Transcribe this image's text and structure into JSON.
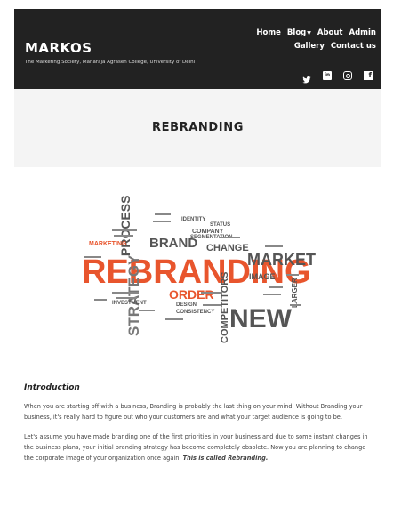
{
  "header": {
    "site_title": "MARKOS",
    "site_description": "The Marketing Society, Maharaja Agrasen College, University of Delhi",
    "nav": {
      "home": "Home",
      "blog": "Blog",
      "about": "About",
      "admin": "Admin",
      "gallery": "Gallery",
      "contact": "Contact us"
    },
    "social_icons": [
      "twitter-icon",
      "linkedin-icon",
      "instagram-icon",
      "facebook-icon"
    ]
  },
  "page": {
    "title": "REBRANDING"
  },
  "image": {
    "words": [
      "REBRANDING",
      "MARKET",
      "NEW",
      "STRATEGY",
      "PROCESS",
      "BRAND",
      "ORDER",
      "COMPETITORS",
      "IMAGE",
      "CHANGE",
      "MARKETING",
      "LARGER",
      "IDENTITY",
      "STATUS",
      "COMPANY",
      "CONSISTENCY",
      "SEGMENTATION",
      "INVESTMENT",
      "DESIGN"
    ]
  },
  "article": {
    "heading": "Introduction",
    "para1": "When you are starting off with a business, Branding is probably the last thing on your mind. Without Branding your business, it's really hard to figure out who your customers are and what your target audience is going to be.",
    "para2": "Let's assume you have made branding one of the first priorities in your business and due to some instant changes in the business plans, your initial branding strategy has become  completely obsolete. Now you are planning to change the corporate image of your organization once again.",
    "para2_emphasis": "This is called Rebranding."
  },
  "colors": {
    "header_bg": "#222222",
    "title_band_bg": "#f4f4f4",
    "accent_orange": "#e8552d",
    "wordcloud_gray": "#555555"
  }
}
